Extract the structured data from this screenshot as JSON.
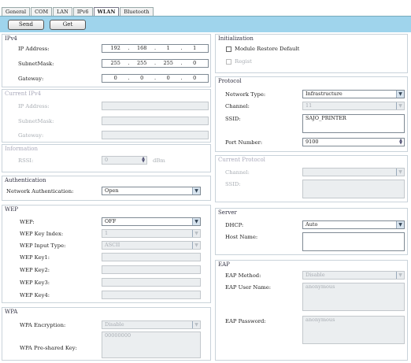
{
  "tabs": [
    "General",
    "COM",
    "LAN",
    "IPv6",
    "WLAN",
    "Bluetooth"
  ],
  "active_tab": "WLAN",
  "toolbar": {
    "send_label": "Send",
    "get_label": "Get"
  },
  "ipv4": {
    "title": "IPv4",
    "ip_label": "IP Address:",
    "ip": [
      "192",
      "168",
      "1",
      "1"
    ],
    "mask_label": "SubnetMask:",
    "mask": [
      "255",
      "255",
      "255",
      "0"
    ],
    "gw_label": "Gateway:",
    "gw": [
      "0",
      "0",
      "0",
      "0"
    ]
  },
  "current_ipv4": {
    "title": "Current IPv4",
    "ip_label": "IP Address:",
    "mask_label": "SubnetMask:",
    "gw_label": "Gateway:"
  },
  "information": {
    "title": "Information",
    "rssi_label": "RSSI:",
    "rssi_value": "0",
    "rssi_unit": "dBm"
  },
  "authentication": {
    "title": "Authentication",
    "label": "Network Authentication:",
    "value": "Open"
  },
  "wep": {
    "title": "WEP",
    "wep_label": "WEP:",
    "wep_value": "OFF",
    "key_index_label": "WEP Key Index:",
    "key_index_value": "1",
    "input_type_label": "WEP Input Type:",
    "input_type_value": "ASCII",
    "key1_label": "WEP Key1:",
    "key2_label": "WEP Key2:",
    "key3_label": "WEP Key3:",
    "key4_label": "WEP Key4:"
  },
  "wpa": {
    "title": "WPA",
    "encryption_label": "WPA Encryption:",
    "encryption_value": "Disable",
    "psk_label": "WPA Pre-shared Key:",
    "psk_value": "00000000"
  },
  "initialization": {
    "title": "Initialization",
    "module_reset_label": "Module Restore Default",
    "regist_label": "Regist"
  },
  "protocol": {
    "title": "Protocol",
    "network_type_label": "Network Type:",
    "network_type_value": "Infrastructure",
    "channel_label": "Channel:",
    "channel_value": "11",
    "ssid_label": "SSID:",
    "ssid_value": "SAJO_PRINTER",
    "port_label": "Port Number:",
    "port_value": "9100"
  },
  "current_protocol": {
    "title": "Current Protocol",
    "channel_label": "Channel:",
    "ssid_label": "SSID:"
  },
  "server": {
    "title": "Server",
    "dhcp_label": "DHCP:",
    "dhcp_value": "Auto",
    "host_label": "Host Name:"
  },
  "eap": {
    "title": "EAP",
    "method_label": "EAP Method:",
    "method_value": "Disable",
    "user_label": "EAP User Name:",
    "user_value": "anonymous",
    "password_label": "EAP Password:",
    "password_value": "anonymous"
  },
  "colors": {
    "toolbar": "#9fd4ec",
    "panel_border": "#c9d3da",
    "disabled_field": "#ebeef0"
  }
}
